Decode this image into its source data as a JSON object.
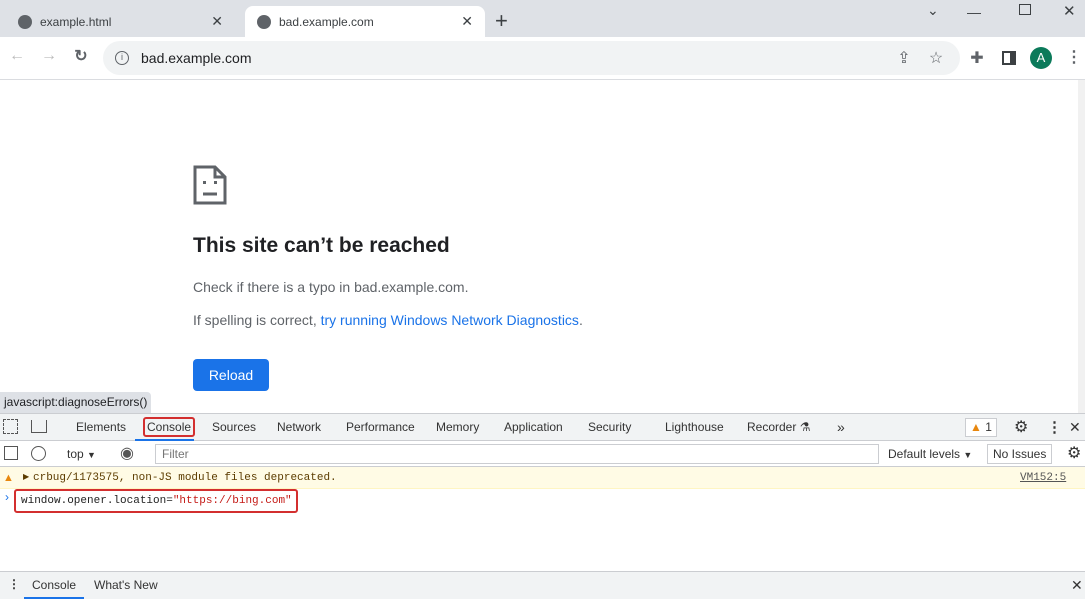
{
  "browser": {
    "tabs": [
      {
        "title": "example.html",
        "active": false
      },
      {
        "title": "bad.example.com",
        "active": true
      }
    ],
    "address": "bad.example.com",
    "profile_initial": "A"
  },
  "page": {
    "title": "This site can’t be reached",
    "line1": "Check if there is a typo in bad.example.com.",
    "line2_prefix": "If spelling is correct, ",
    "line2_link": "try running Windows Network Diagnostics",
    "line2_suffix": ".",
    "reload_label": "Reload",
    "status_url": "javascript:diagnoseErrors()",
    "accent": "#1a73e8"
  },
  "devtools": {
    "tabs": [
      "Elements",
      "Console",
      "Sources",
      "Network",
      "Performance",
      "Memory",
      "Application",
      "Security",
      "Lighthouse",
      "Recorder"
    ],
    "active_tab": "Console",
    "warning_count": "1",
    "context": "top",
    "filter_placeholder": "Filter",
    "levels": "Default levels",
    "issues": "No Issues",
    "messages": [
      {
        "level": "warning",
        "text": "crbug/1173575, non-JS module files deprecated.",
        "source": "VM152:5"
      }
    ],
    "command_code": "window.opener.location=",
    "command_string": "\"https://bing.com\"",
    "drawer_tabs": [
      "Console",
      "What's New"
    ],
    "highlight_color": "#d32f2f"
  }
}
